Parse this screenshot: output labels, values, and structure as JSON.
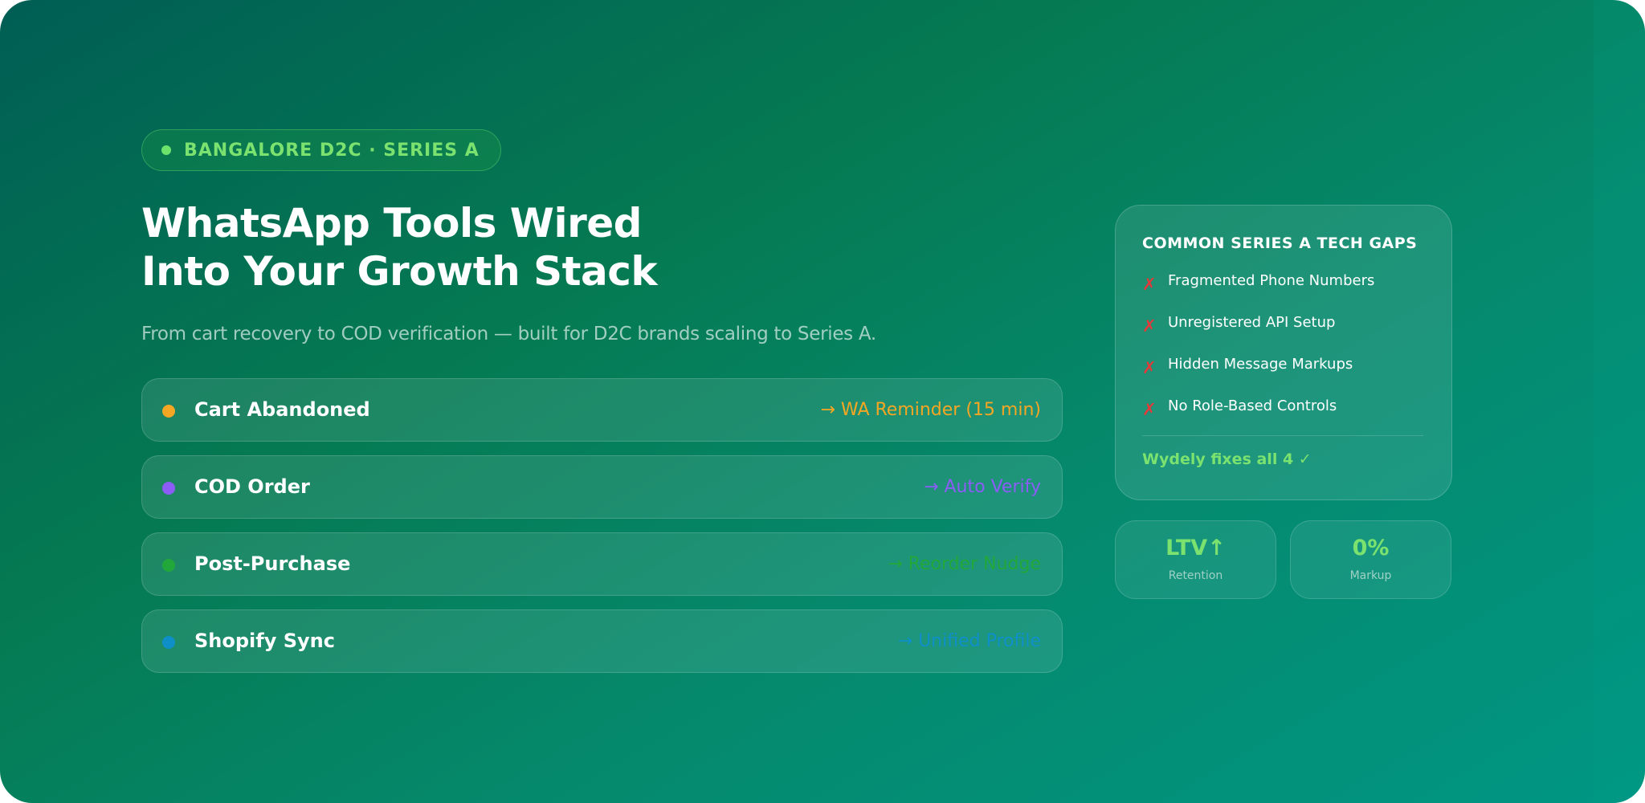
{
  "badge": {
    "text": "BANGALORE D2C · SERIES A"
  },
  "hero": {
    "title_line1": "WhatsApp Tools Wired",
    "title_line2": "Into Your Growth Stack",
    "subtitle": "From cart recovery to COD verification — built for D2C brands scaling to Series A."
  },
  "flows": [
    {
      "label": "Cart Abandoned",
      "action": "→ WA Reminder (15 min)",
      "color": "#f5a623"
    },
    {
      "label": "COD Order",
      "action": "→ Auto Verify",
      "color": "#8b5cf6"
    },
    {
      "label": "Post-Purchase",
      "action": "→ Reorder Nudge",
      "color": "#22a83a"
    },
    {
      "label": "Shopify Sync",
      "action": "→ Unified Profile",
      "color": "#0f8fc8"
    }
  ],
  "gaps": {
    "title": "COMMON SERIES A TECH GAPS",
    "items": [
      {
        "mark": "✗",
        "text": "Fragmented Phone Numbers"
      },
      {
        "mark": "✗",
        "text": "Unregistered API Setup"
      },
      {
        "mark": "✗",
        "text": "Hidden Message Markups"
      },
      {
        "mark": "✗",
        "text": "No Role-Based Controls"
      }
    ],
    "footer": "Wydely fixes all 4 ✓"
  },
  "stats": [
    {
      "value": "LTV↑",
      "label": "Retention"
    },
    {
      "value": "0%",
      "label": "Markup"
    }
  ],
  "colors": {
    "accent_green": "#7be26f",
    "cross_red": "#e03a3a"
  }
}
